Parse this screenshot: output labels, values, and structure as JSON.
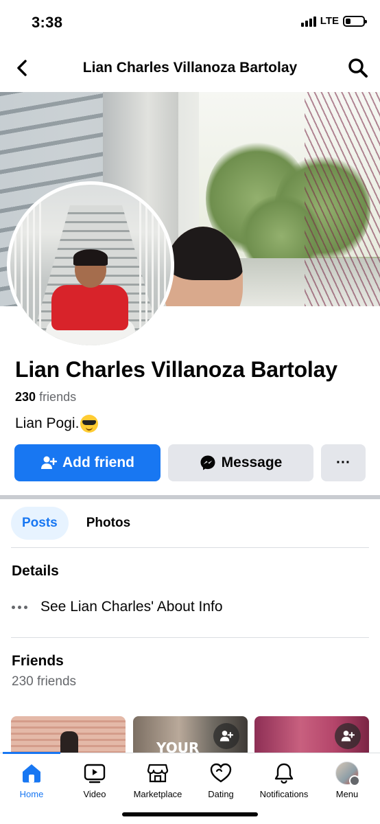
{
  "status_bar": {
    "time": "3:38",
    "network": "LTE"
  },
  "header": {
    "title": "Lian Charles Villanoza Bartolay"
  },
  "profile": {
    "name": "Lian Charles Villanoza Bartolay",
    "friends_count": "230",
    "friends_word": "friends",
    "bio": "Lian Pogi."
  },
  "actions": {
    "add_friend": "Add friend",
    "message": "Message",
    "more": "···"
  },
  "tabs": [
    {
      "label": "Posts",
      "active": true
    },
    {
      "label": "Photos",
      "active": false
    }
  ],
  "details": {
    "title": "Details",
    "about_link": "See Lian Charles' About Info"
  },
  "friends": {
    "title": "Friends",
    "count_text": "230 friends"
  },
  "friend_thumbs": [
    {
      "sign": ""
    },
    {
      "sign": "YOUR"
    },
    {
      "sign": ""
    }
  ],
  "tabbar": [
    {
      "label": "Home",
      "icon": "home-icon",
      "active": true
    },
    {
      "label": "Video",
      "icon": "video-icon",
      "active": false
    },
    {
      "label": "Marketplace",
      "icon": "marketplace-icon",
      "active": false
    },
    {
      "label": "Dating",
      "icon": "dating-icon",
      "active": false
    },
    {
      "label": "Notifications",
      "icon": "bell-icon",
      "active": false
    },
    {
      "label": "Menu",
      "icon": "menu-avatar",
      "active": false
    }
  ],
  "colors": {
    "accent": "#1877f2",
    "secondary_button": "#e4e6eb",
    "muted_text": "#65676b"
  }
}
